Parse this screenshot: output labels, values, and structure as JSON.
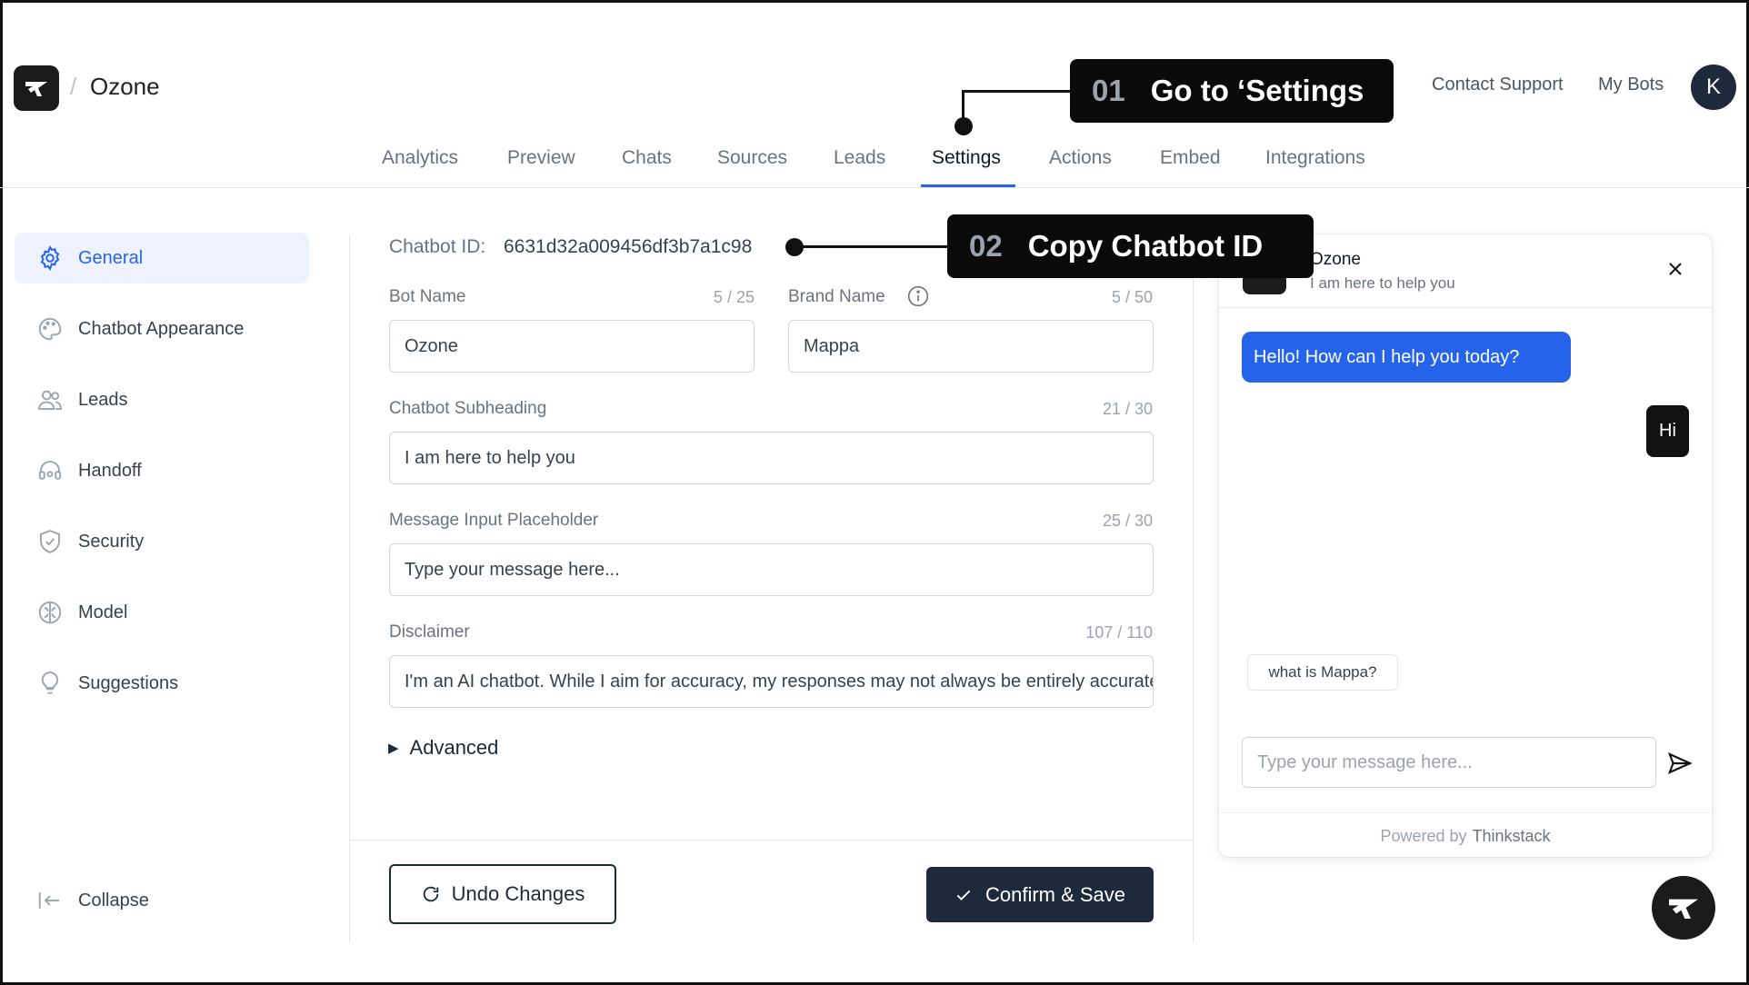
{
  "header": {
    "breadcrumb_separator": "/",
    "project_name": "Ozone",
    "links": [
      "Contact Support",
      "My Bots"
    ],
    "avatar_initial": "K"
  },
  "tabs": [
    {
      "label": "Analytics",
      "active": false
    },
    {
      "label": "Preview",
      "active": false
    },
    {
      "label": "Chats",
      "active": false
    },
    {
      "label": "Sources",
      "active": false
    },
    {
      "label": "Leads",
      "active": false
    },
    {
      "label": "Settings",
      "active": true
    },
    {
      "label": "Actions",
      "active": false
    },
    {
      "label": "Embed",
      "active": false
    },
    {
      "label": "Integrations",
      "active": false
    }
  ],
  "sidebar": {
    "items": [
      {
        "label": "General",
        "icon": "gear-icon",
        "active": true
      },
      {
        "label": "Chatbot Appearance",
        "icon": "palette-icon",
        "active": false
      },
      {
        "label": "Leads",
        "icon": "users-icon",
        "active": false
      },
      {
        "label": "Handoff",
        "icon": "headset-icon",
        "active": false
      },
      {
        "label": "Security",
        "icon": "shield-icon",
        "active": false
      },
      {
        "label": "Model",
        "icon": "brain-icon",
        "active": false
      },
      {
        "label": "Suggestions",
        "icon": "lightbulb-icon",
        "active": false
      }
    ],
    "collapse_label": "Collapse"
  },
  "form": {
    "chatbot_id_label": "Chatbot ID:",
    "chatbot_id_value": "6631d32a009456df3b7a1c98",
    "bot_name": {
      "label": "Bot Name",
      "count": "5 / 25",
      "value": "Ozone"
    },
    "brand_name": {
      "label": "Brand Name",
      "count": "5 / 50",
      "value": "Mappa"
    },
    "subheading": {
      "label": "Chatbot Subheading",
      "count": "21 / 30",
      "value": "I am here to help you"
    },
    "placeholder": {
      "label": "Message Input Placeholder",
      "count": "25 / 30",
      "value": "Type your message here..."
    },
    "disclaimer": {
      "label": "Disclaimer",
      "count": "107 / 110",
      "value": "I'm an AI chatbot. While I aim for accuracy, my responses may not always be entirely accurate."
    },
    "advanced_label": "Advanced",
    "undo_label": "Undo Changes",
    "save_label": "Confirm & Save"
  },
  "preview": {
    "title": "Ozone",
    "subtitle": "I am here to help you",
    "bot_message": "Hello! How can I help you today?",
    "user_message": "Hi",
    "suggestion": "what is Mappa?",
    "input_placeholder": "Type your message here...",
    "powered_by": "Powered by",
    "powered_brand": "Thinkstack"
  },
  "callouts": [
    {
      "num": "01",
      "text": "Go to ‘Settings"
    },
    {
      "num": "02",
      "text": "Copy Chatbot ID"
    }
  ],
  "colors": {
    "accent": "#2563eb",
    "dark": "#1e293b",
    "active_bg": "#eef2ff"
  }
}
